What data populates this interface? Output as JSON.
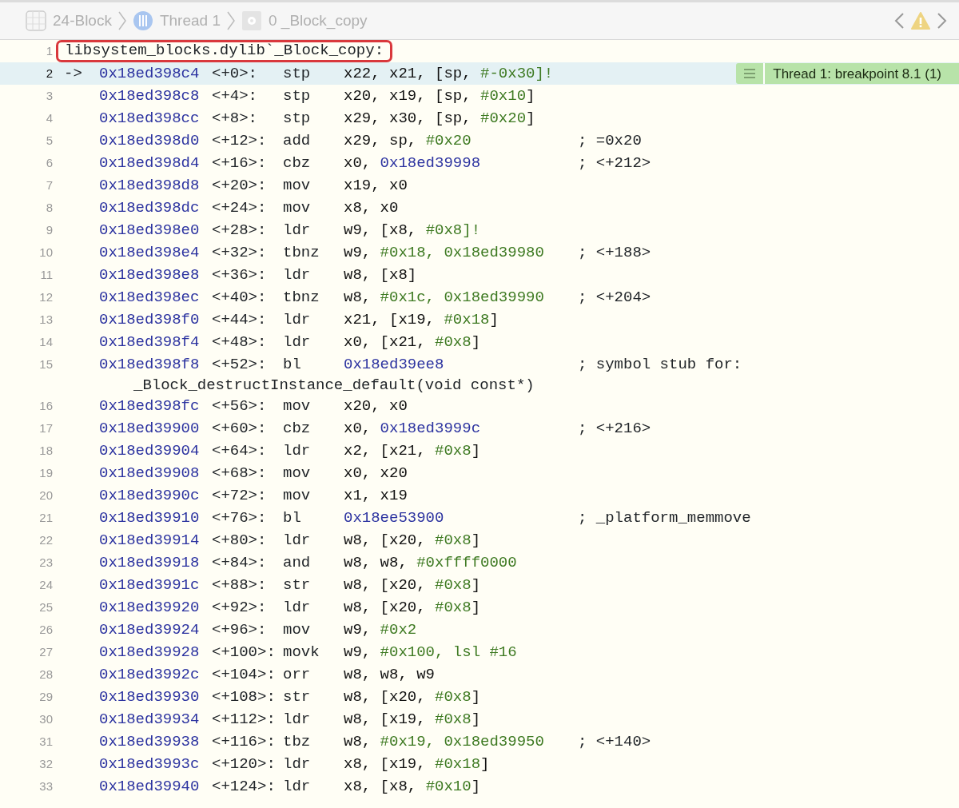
{
  "breadcrumb": [
    {
      "kind": "project",
      "label": "24-Block"
    },
    {
      "kind": "thread",
      "label": "Thread 1"
    },
    {
      "kind": "frame",
      "label": "0 _Block_copy"
    }
  ],
  "header_line": {
    "line": "1",
    "text": "libsystem_blocks.dylib`_Block_copy:",
    "outlined": true
  },
  "rows": [
    {
      "line": "2",
      "current": true,
      "arrow": "->",
      "address": "0x18ed398c4",
      "offset": "<+0>:",
      "mnemonic": "stp",
      "operands": [
        {
          "text": "x22, x21, [sp, ",
          "kind": "reg"
        },
        {
          "text": "#-0x30]!",
          "kind": "imm"
        }
      ],
      "annotation": "Thread 1: breakpoint 8.1 (1)"
    },
    {
      "line": "3",
      "current": false,
      "address": "0x18ed398c8",
      "offset": "<+4>:",
      "mnemonic": "stp",
      "operands": [
        {
          "text": "x20, x19, [sp, ",
          "kind": "reg"
        },
        {
          "text": "#0x10",
          "kind": "imm"
        },
        {
          "text": "]",
          "kind": "reg"
        }
      ]
    },
    {
      "line": "4",
      "current": false,
      "address": "0x18ed398cc",
      "offset": "<+8>:",
      "mnemonic": "stp",
      "operands": [
        {
          "text": "x29, x30, [sp, ",
          "kind": "reg"
        },
        {
          "text": "#0x20",
          "kind": "imm"
        },
        {
          "text": "]",
          "kind": "reg"
        }
      ]
    },
    {
      "line": "5",
      "current": false,
      "address": "0x18ed398d0",
      "offset": "<+12>:",
      "mnemonic": "add",
      "operands": [
        {
          "text": "x29, sp, ",
          "kind": "reg"
        },
        {
          "text": "#0x20",
          "kind": "imm"
        }
      ],
      "comment": "; =0x20"
    },
    {
      "line": "6",
      "current": false,
      "address": "0x18ed398d4",
      "offset": "<+16>:",
      "mnemonic": "cbz",
      "operands": [
        {
          "text": "x0, ",
          "kind": "reg"
        },
        {
          "text": "0x18ed39998",
          "kind": "addr"
        }
      ],
      "comment": "; <+212>"
    },
    {
      "line": "7",
      "current": false,
      "address": "0x18ed398d8",
      "offset": "<+20>:",
      "mnemonic": "mov",
      "operands": [
        {
          "text": "x19, x0",
          "kind": "reg"
        }
      ]
    },
    {
      "line": "8",
      "current": false,
      "address": "0x18ed398dc",
      "offset": "<+24>:",
      "mnemonic": "mov",
      "operands": [
        {
          "text": "x8, x0",
          "kind": "reg"
        }
      ]
    },
    {
      "line": "9",
      "current": false,
      "address": "0x18ed398e0",
      "offset": "<+28>:",
      "mnemonic": "ldr",
      "operands": [
        {
          "text": "w9, [x8, ",
          "kind": "reg"
        },
        {
          "text": "#0x8]!",
          "kind": "imm"
        }
      ]
    },
    {
      "line": "10",
      "current": false,
      "address": "0x18ed398e4",
      "offset": "<+32>:",
      "mnemonic": "tbnz",
      "operands": [
        {
          "text": "w9, ",
          "kind": "reg"
        },
        {
          "text": "#0x18, 0x18ed39980",
          "kind": "imm"
        }
      ],
      "comment": "; <+188>"
    },
    {
      "line": "11",
      "current": false,
      "address": "0x18ed398e8",
      "offset": "<+36>:",
      "mnemonic": "ldr",
      "operands": [
        {
          "text": "w8, [x8]",
          "kind": "reg"
        }
      ]
    },
    {
      "line": "12",
      "current": false,
      "address": "0x18ed398ec",
      "offset": "<+40>:",
      "mnemonic": "tbnz",
      "operands": [
        {
          "text": "w8, ",
          "kind": "reg"
        },
        {
          "text": "#0x1c, 0x18ed39990",
          "kind": "imm"
        }
      ],
      "comment": "; <+204>"
    },
    {
      "line": "13",
      "current": false,
      "address": "0x18ed398f0",
      "offset": "<+44>:",
      "mnemonic": "ldr",
      "operands": [
        {
          "text": "x21, [x19, ",
          "kind": "reg"
        },
        {
          "text": "#0x18",
          "kind": "imm"
        },
        {
          "text": "]",
          "kind": "reg"
        }
      ]
    },
    {
      "line": "14",
      "current": false,
      "address": "0x18ed398f4",
      "offset": "<+48>:",
      "mnemonic": "ldr",
      "operands": [
        {
          "text": "x0, [x21, ",
          "kind": "reg"
        },
        {
          "text": "#0x8",
          "kind": "imm"
        },
        {
          "text": "]",
          "kind": "reg"
        }
      ]
    },
    {
      "line": "15",
      "current": false,
      "address": "0x18ed398f8",
      "offset": "<+52>:",
      "mnemonic": "bl",
      "operands": [
        {
          "text": "0x18ed39ee8",
          "kind": "addr"
        }
      ],
      "comment": "; symbol stub for:",
      "continuation": "_Block_destructInstance_default(void const*)"
    },
    {
      "line": "16",
      "current": false,
      "address": "0x18ed398fc",
      "offset": "<+56>:",
      "mnemonic": "mov",
      "operands": [
        {
          "text": "x20, x0",
          "kind": "reg"
        }
      ]
    },
    {
      "line": "17",
      "current": false,
      "address": "0x18ed39900",
      "offset": "<+60>:",
      "mnemonic": "cbz",
      "operands": [
        {
          "text": "x0, ",
          "kind": "reg"
        },
        {
          "text": "0x18ed3999c",
          "kind": "addr"
        }
      ],
      "comment": "; <+216>"
    },
    {
      "line": "18",
      "current": false,
      "address": "0x18ed39904",
      "offset": "<+64>:",
      "mnemonic": "ldr",
      "operands": [
        {
          "text": "x2, [x21, ",
          "kind": "reg"
        },
        {
          "text": "#0x8",
          "kind": "imm"
        },
        {
          "text": "]",
          "kind": "reg"
        }
      ]
    },
    {
      "line": "19",
      "current": false,
      "address": "0x18ed39908",
      "offset": "<+68>:",
      "mnemonic": "mov",
      "operands": [
        {
          "text": "x0, x20",
          "kind": "reg"
        }
      ]
    },
    {
      "line": "20",
      "current": false,
      "address": "0x18ed3990c",
      "offset": "<+72>:",
      "mnemonic": "mov",
      "operands": [
        {
          "text": "x1, x19",
          "kind": "reg"
        }
      ]
    },
    {
      "line": "21",
      "current": false,
      "address": "0x18ed39910",
      "offset": "<+76>:",
      "mnemonic": "bl",
      "operands": [
        {
          "text": "0x18ee53900",
          "kind": "addr"
        }
      ],
      "comment": "; _platform_memmove"
    },
    {
      "line": "22",
      "current": false,
      "address": "0x18ed39914",
      "offset": "<+80>:",
      "mnemonic": "ldr",
      "operands": [
        {
          "text": "w8, [x20, ",
          "kind": "reg"
        },
        {
          "text": "#0x8",
          "kind": "imm"
        },
        {
          "text": "]",
          "kind": "reg"
        }
      ]
    },
    {
      "line": "23",
      "current": false,
      "address": "0x18ed39918",
      "offset": "<+84>:",
      "mnemonic": "and",
      "operands": [
        {
          "text": "w8, w8, ",
          "kind": "reg"
        },
        {
          "text": "#0xffff0000",
          "kind": "imm"
        }
      ]
    },
    {
      "line": "24",
      "current": false,
      "address": "0x18ed3991c",
      "offset": "<+88>:",
      "mnemonic": "str",
      "operands": [
        {
          "text": "w8, [x20, ",
          "kind": "reg"
        },
        {
          "text": "#0x8",
          "kind": "imm"
        },
        {
          "text": "]",
          "kind": "reg"
        }
      ]
    },
    {
      "line": "25",
      "current": false,
      "address": "0x18ed39920",
      "offset": "<+92>:",
      "mnemonic": "ldr",
      "operands": [
        {
          "text": "w8, [x20, ",
          "kind": "reg"
        },
        {
          "text": "#0x8",
          "kind": "imm"
        },
        {
          "text": "]",
          "kind": "reg"
        }
      ]
    },
    {
      "line": "26",
      "current": false,
      "address": "0x18ed39924",
      "offset": "<+96>:",
      "mnemonic": "mov",
      "operands": [
        {
          "text": "w9, ",
          "kind": "reg"
        },
        {
          "text": "#0x2",
          "kind": "imm"
        }
      ]
    },
    {
      "line": "27",
      "current": false,
      "address": "0x18ed39928",
      "offset": "<+100>:",
      "mnemonic": "movk",
      "operands": [
        {
          "text": "w9, ",
          "kind": "reg"
        },
        {
          "text": "#0x100, lsl #16",
          "kind": "imm"
        }
      ]
    },
    {
      "line": "28",
      "current": false,
      "address": "0x18ed3992c",
      "offset": "<+104>:",
      "mnemonic": "orr",
      "operands": [
        {
          "text": "w8, w8, w9",
          "kind": "reg"
        }
      ]
    },
    {
      "line": "29",
      "current": false,
      "address": "0x18ed39930",
      "offset": "<+108>:",
      "mnemonic": "str",
      "operands": [
        {
          "text": "w8, [x20, ",
          "kind": "reg"
        },
        {
          "text": "#0x8",
          "kind": "imm"
        },
        {
          "text": "]",
          "kind": "reg"
        }
      ]
    },
    {
      "line": "30",
      "current": false,
      "address": "0x18ed39934",
      "offset": "<+112>:",
      "mnemonic": "ldr",
      "operands": [
        {
          "text": "w8, [x19, ",
          "kind": "reg"
        },
        {
          "text": "#0x8",
          "kind": "imm"
        },
        {
          "text": "]",
          "kind": "reg"
        }
      ]
    },
    {
      "line": "31",
      "current": false,
      "address": "0x18ed39938",
      "offset": "<+116>:",
      "mnemonic": "tbz",
      "operands": [
        {
          "text": "w8, ",
          "kind": "reg"
        },
        {
          "text": "#0x19, 0x18ed39950",
          "kind": "imm"
        }
      ],
      "comment": "; <+140>"
    },
    {
      "line": "32",
      "current": false,
      "address": "0x18ed3993c",
      "offset": "<+120>:",
      "mnemonic": "ldr",
      "operands": [
        {
          "text": "x8, [x19, ",
          "kind": "reg"
        },
        {
          "text": "#0x18",
          "kind": "imm"
        },
        {
          "text": "]",
          "kind": "reg"
        }
      ]
    },
    {
      "line": "33",
      "current": false,
      "address": "0x18ed39940",
      "offset": "<+124>:",
      "mnemonic": "ldr",
      "operands": [
        {
          "text": "x8, [x8, ",
          "kind": "reg"
        },
        {
          "text": "#0x10",
          "kind": "imm"
        },
        {
          "text": "]",
          "kind": "reg"
        }
      ]
    }
  ]
}
